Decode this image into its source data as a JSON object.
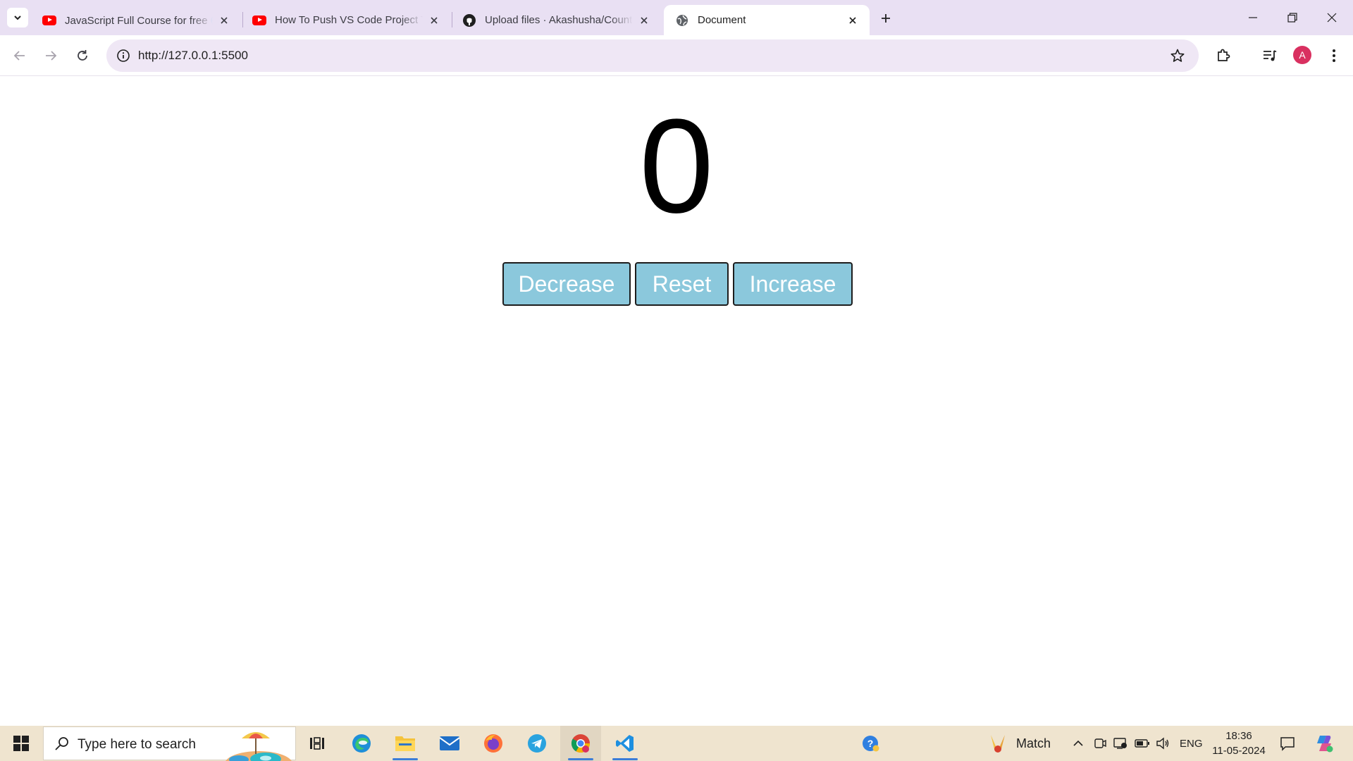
{
  "browser": {
    "tabs": [
      {
        "title": "JavaScript Full Course for free 🌐",
        "icon": "youtube-icon"
      },
      {
        "title": "How To Push VS Code Project To GitHub",
        "icon": "youtube-icon"
      },
      {
        "title": "Upload files · Akashusha/Counter",
        "icon": "github-icon"
      },
      {
        "title": "Document",
        "icon": "globe-icon"
      }
    ],
    "active_tab": 3,
    "url": "http://127.0.0.1:5500",
    "profile_initial": "A",
    "accent_color": "#e9e0f3"
  },
  "page": {
    "counter_value": "0",
    "buttons": {
      "decrease": "Decrease",
      "reset": "Reset",
      "increase": "Increase"
    },
    "button_color": "#8bc8dc"
  },
  "taskbar": {
    "search_placeholder": "Type here to search",
    "pinned_apps": [
      "task-view-icon",
      "edge-icon",
      "file-explorer-icon",
      "mail-icon",
      "firefox-icon",
      "telegram-icon",
      "chrome-icon",
      "vscode-icon"
    ],
    "weather_widget": "Match",
    "language": "ENG",
    "time": "18:36",
    "date": "11-05-2024"
  }
}
